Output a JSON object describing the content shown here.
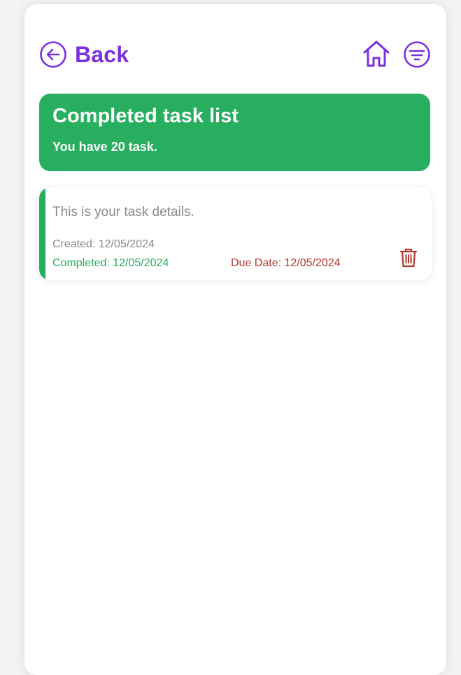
{
  "header": {
    "back_label": "Back",
    "back_icon": "arrow-left-circle-icon",
    "home_icon": "home-icon",
    "filter_icon": "filter-icon"
  },
  "banner": {
    "title": "Completed task list",
    "subtitle": "You have 20 task."
  },
  "tasks": [
    {
      "details": "This is your task details.",
      "created": "Created: 12/05/2024",
      "completed": "Completed: 12/05/2024",
      "due": "Due Date: 12/05/2024",
      "delete_icon": "trash-icon"
    }
  ],
  "colors": {
    "accent_purple": "#7c2fe0",
    "success_green": "#28ae5f",
    "danger_red": "#b3362e",
    "muted_text": "#8a8a8a"
  }
}
